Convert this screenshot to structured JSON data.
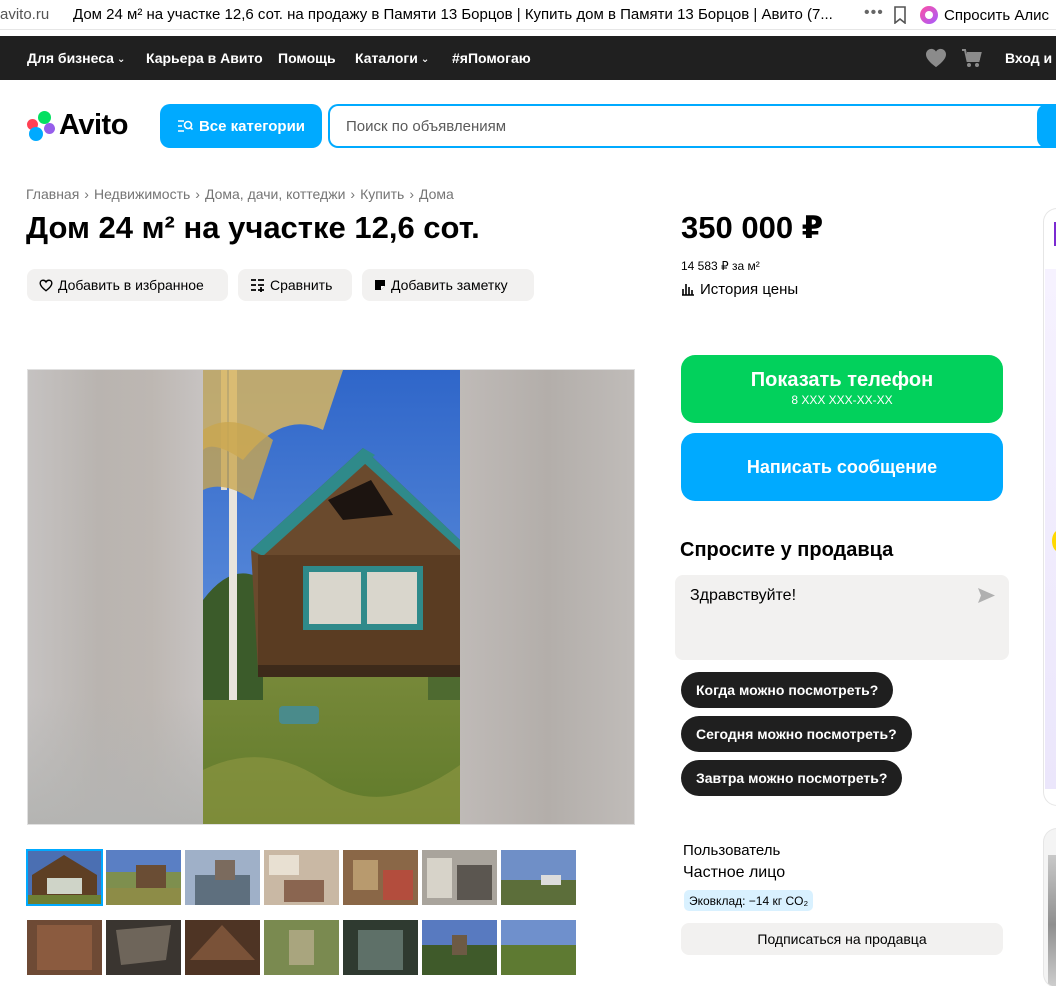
{
  "browser": {
    "domain": "avito.ru",
    "tab_title": "Дом 24 м² на участке 12,6 сот. на продажу в Памяти 13 Борцов | Купить дом в Памяти 13 Борцов | Авито (7...",
    "alice_label": "Спросить Алис"
  },
  "topnav": {
    "items": [
      {
        "label": "Для бизнеса",
        "has_dropdown": true
      },
      {
        "label": "Карьера в Авито",
        "has_dropdown": false
      },
      {
        "label": "Помощь",
        "has_dropdown": false
      },
      {
        "label": "Каталоги",
        "has_dropdown": true
      },
      {
        "label": "#яПомогаю",
        "has_dropdown": false
      }
    ],
    "login_label": "Вход и р"
  },
  "header": {
    "logo_text": "Avito",
    "all_categories_label": "Все категории",
    "search_placeholder": "Поиск по объявлениям"
  },
  "breadcrumb": [
    "Главная",
    "Недвижимость",
    "Дома, дачи, коттеджи",
    "Купить",
    "Дома"
  ],
  "listing": {
    "title": "Дом 24 м² на участке 12,6 сот.",
    "actions": {
      "favorite": "Добавить в избранное",
      "compare": "Сравнить",
      "note": "Добавить заметку"
    },
    "price": "350 000 ₽",
    "price_per_sqm": "14 583 ₽ за м²",
    "price_history": "История цены"
  },
  "contact": {
    "show_phone": "Показать телефон",
    "phone_mask": "8 XXX XXX-XX-XX",
    "write_message": "Написать сообщение",
    "ask_title": "Спросите у продавца",
    "ask_message": "Здравствуйте!",
    "quick_questions": [
      "Когда можно посмотреть?",
      "Сегодня можно посмотреть?",
      "Завтра можно посмотреть?"
    ]
  },
  "seller": {
    "name": "Пользователь",
    "type": "Частное лицо",
    "eco": "Эковклад: −14 кг CO₂",
    "subscribe": "Подписаться на продавца"
  },
  "colors": {
    "accent": "#00aaff",
    "green": "#02d15c",
    "dark": "#202020"
  }
}
